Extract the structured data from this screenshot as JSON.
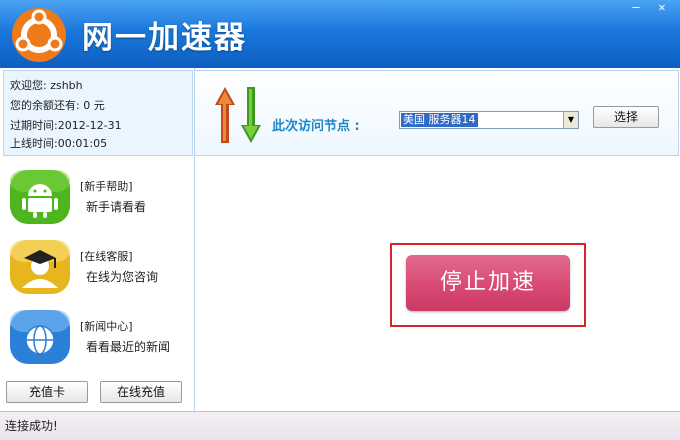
{
  "app": {
    "title": "网一加速器"
  },
  "window_controls": {
    "minimize": "—",
    "close": "✕"
  },
  "user": {
    "welcome": "欢迎您: zshbh",
    "balance": "您的余额还有: 0 元",
    "expiry": "过期时间:2012-12-31",
    "online": "上线时间:00:01:05"
  },
  "node": {
    "label": "此次访问节点 :",
    "selected": "美国 服务器14",
    "select_button": "选择"
  },
  "menu": [
    {
      "title": "[新手帮助]",
      "sub": "新手请看看",
      "icon": "android-icon"
    },
    {
      "title": "[在线客服]",
      "sub": "在线为您咨询",
      "icon": "graduate-icon"
    },
    {
      "title": "[新闻中心]",
      "sub": "看看最近的新闻",
      "icon": "globe-folder-icon"
    }
  ],
  "buttons": {
    "recharge_card": "充值卡",
    "online_recharge": "在线充值"
  },
  "main": {
    "stop_button": "停止加速"
  },
  "status": {
    "text": "连接成功!"
  },
  "colors": {
    "titlebar": "#1a78dc",
    "accent": "#d84a74",
    "highlight_border": "#d9232a",
    "node_label": "#1f86c7"
  }
}
